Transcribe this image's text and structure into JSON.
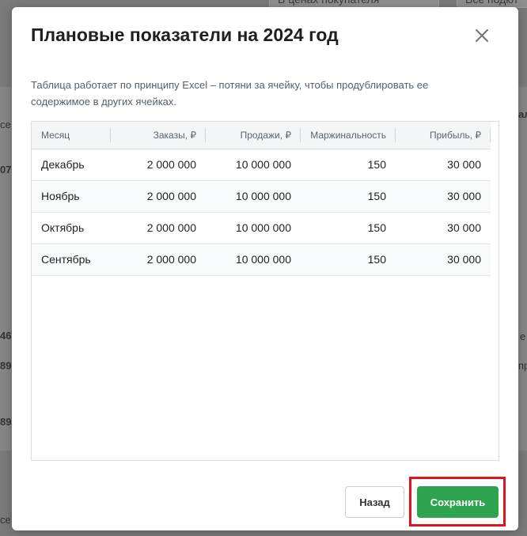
{
  "background": {
    "select_left": "В ценах покупателя",
    "select_right": "Все подкл",
    "fragments": [
      "се",
      "07",
      "ал",
      "46",
      "89",
      "е",
      "пр",
      "89",
      "се"
    ]
  },
  "modal": {
    "title": "Плановые показатели на 2024 год",
    "description": "Таблица работает по принципу Excel – потяни за ячейку, чтобы продублировать ее содержимое в других ячейках.",
    "table": {
      "columns": [
        "Месяц",
        "Заказы, ₽",
        "Продажи, ₽",
        "Маржинальность",
        "Прибыль, ₽"
      ],
      "rows": [
        [
          "Декабрь",
          "2 000 000",
          "10 000 000",
          "150",
          "30 000"
        ],
        [
          "Ноябрь",
          "2 000 000",
          "10 000 000",
          "150",
          "30 000"
        ],
        [
          "Октябрь",
          "2 000 000",
          "10 000 000",
          "150",
          "30 000"
        ],
        [
          "Сентябрь",
          "2 000 000",
          "10 000 000",
          "150",
          "30 000"
        ]
      ]
    },
    "back_label": "Назад",
    "save_label": "Сохранить"
  },
  "colors": {
    "accent": "#2ea44f",
    "highlight": "#e0141e"
  },
  "icons": {
    "close": "close-icon"
  }
}
